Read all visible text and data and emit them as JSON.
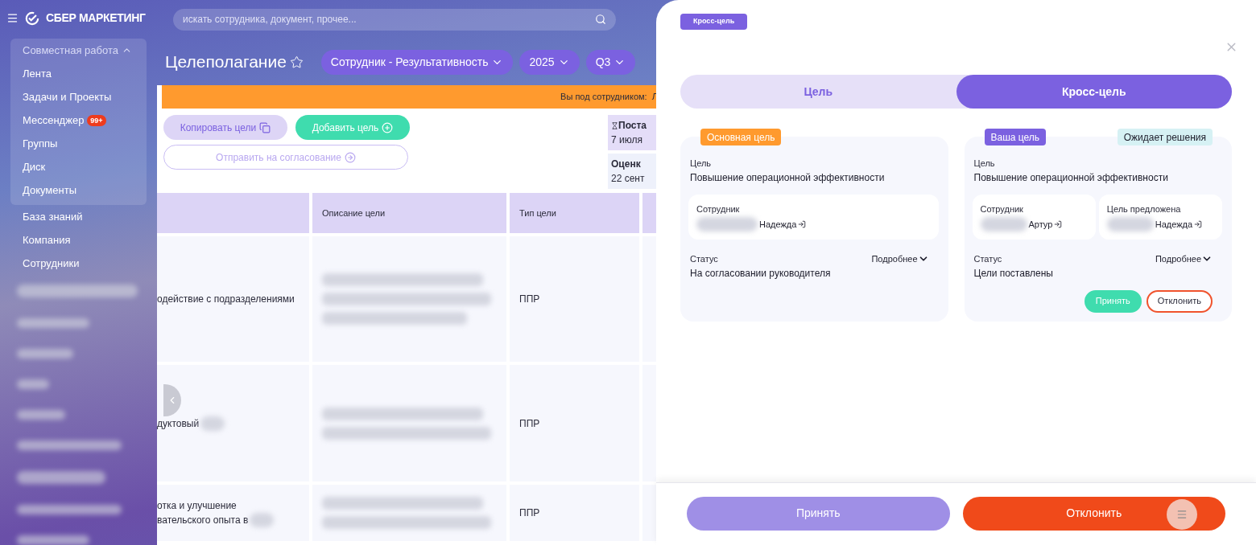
{
  "header": {
    "logo": "СБЕР МАРКЕТИНГ",
    "search_placeholder": "искать сотрудника, документ, прочее..."
  },
  "sidebar": {
    "group": {
      "label": "Совместная работа",
      "expanded": true,
      "items": [
        {
          "label": "Лента"
        },
        {
          "label": "Задачи и Проекты"
        },
        {
          "label": "Мессенджер",
          "badge": "99+"
        },
        {
          "label": "Группы"
        },
        {
          "label": "Диск"
        },
        {
          "label": "Документы"
        }
      ]
    },
    "items": [
      {
        "label": "База знаний"
      },
      {
        "label": "Компания"
      },
      {
        "label": "Сотрудники"
      }
    ]
  },
  "page": {
    "title": "Целеполагание",
    "filters": [
      "Сотрудник - Результативность",
      "2025",
      "Q3"
    ]
  },
  "banner": "Вы под сотрудником:  Л",
  "actions": [
    {
      "kind": "copy",
      "label": "Копировать цели"
    },
    {
      "kind": "add",
      "label": "Добавить цель"
    },
    {
      "kind": "send",
      "label": "Отправить на согласование"
    }
  ],
  "deadlines": [
    {
      "label": "Поста",
      "date": "7 июля"
    },
    {
      "label": "Оценк",
      "date": "22 сент"
    }
  ],
  "table": {
    "columns": [
      "Описание цели",
      "Тип цели"
    ],
    "rows": [
      {
        "column_1": [
          "одействие с подразделениями"
        ],
        "type": "ППР"
      },
      {
        "column_1": [
          "дуктовый"
        ],
        "type": "ППР"
      },
      {
        "column_1": [
          "отка и улучшение",
          "вательского опыта в"
        ],
        "type": "ППР"
      }
    ]
  },
  "drawer": {
    "tag": "Кросс-цель",
    "tabs": [
      {
        "label": "Цель",
        "selected": false
      },
      {
        "label": "Кросс-цель",
        "selected": true
      }
    ],
    "cards": [
      {
        "badge": {
          "text": "Основная цель",
          "color": "#ff9a2e"
        },
        "goal_label": "Цель",
        "goal": "Повышение операционной эффективности",
        "people": [
          {
            "label": "Сотрудник",
            "name": "Надежда"
          }
        ],
        "status_label": "Статус",
        "status": "На согласовании руководителя",
        "more": "Подробнее"
      },
      {
        "badge": {
          "text": "Ваша цель",
          "color": "#7b61e0"
        },
        "state": "Ожидает решения",
        "goal_label": "Цель",
        "goal": "Повышение операционной эффективности",
        "people": [
          {
            "label": "Сотрудник",
            "name": "Артур"
          },
          {
            "label": "Цель предложена",
            "name": "Надежда"
          }
        ],
        "status_label": "Статус",
        "status": "Цели поставлены",
        "more": "Подробнее",
        "actions": [
          {
            "kind": "accept",
            "label": "Принять"
          },
          {
            "kind": "reject",
            "label": "Отклонить"
          }
        ]
      }
    ],
    "footer": [
      {
        "kind": "accept",
        "label": "Принять",
        "disabled": true
      },
      {
        "kind": "reject",
        "label": "Отклонить",
        "disabled": false
      }
    ]
  }
}
